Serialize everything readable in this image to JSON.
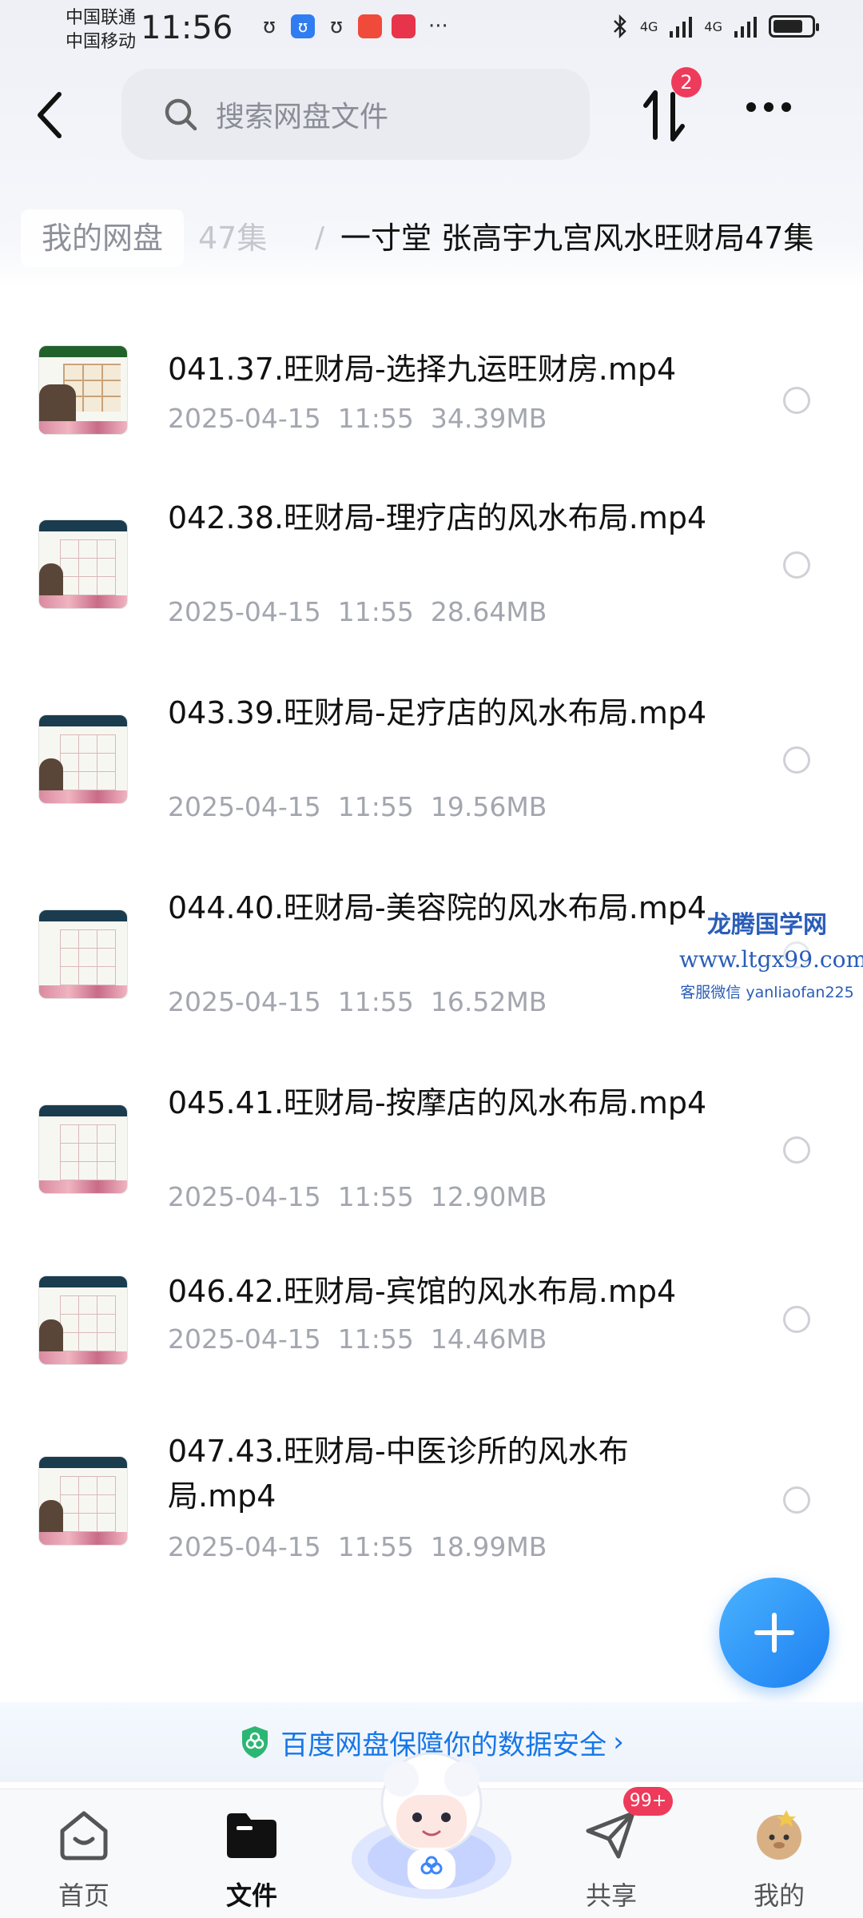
{
  "status": {
    "carrier1": "中国联通",
    "carrier2": "中国移动",
    "time": "11:56",
    "network1": "4G",
    "network2": "4G"
  },
  "header": {
    "search_placeholder": "搜索网盘文件",
    "sort_badge": "2"
  },
  "breadcrumb": {
    "root": "我的网盘",
    "faded": "47集",
    "separator": "/",
    "current": "一寸堂 张高宇九宫风水旺财局47集"
  },
  "files": [
    {
      "title": "041.37.旺财局-选择九运旺财房.mp4",
      "date": "2025-04-15",
      "time": "11:55",
      "size": "34.39MB"
    },
    {
      "title": "042.38.旺财局-理疗店的风水布局.mp4",
      "date": "2025-04-15",
      "time": "11:55",
      "size": "28.64MB"
    },
    {
      "title": "043.39.旺财局-足疗店的风水布局.mp4",
      "date": "2025-04-15",
      "time": "11:55",
      "size": "19.56MB"
    },
    {
      "title": "044.40.旺财局-美容院的风水布局.mp4",
      "date": "2025-04-15",
      "time": "11:55",
      "size": "16.52MB"
    },
    {
      "title": "045.41.旺财局-按摩店的风水布局.mp4",
      "date": "2025-04-15",
      "time": "11:55",
      "size": "12.90MB"
    },
    {
      "title": "046.42.旺财局-宾馆的风水布局.mp4",
      "date": "2025-04-15",
      "time": "11:55",
      "size": "14.46MB"
    },
    {
      "title": "047.43.旺财局-中医诊所的风水布局.mp4",
      "date": "2025-04-15",
      "time": "11:55",
      "size": "18.99MB"
    }
  ],
  "watermark": {
    "line1": "龙腾国学网",
    "line2": "www.ltgx99.com",
    "line3": "客服微信 yanliaofan225"
  },
  "security_banner": {
    "text": "百度网盘保障你的数据安全",
    "chevron": "›"
  },
  "nav": {
    "home": "首页",
    "files": "文件",
    "share": "共享",
    "share_badge": "99+",
    "me": "我的"
  },
  "colors": {
    "accent": "#1677e8",
    "badge": "#ee3b5b"
  }
}
